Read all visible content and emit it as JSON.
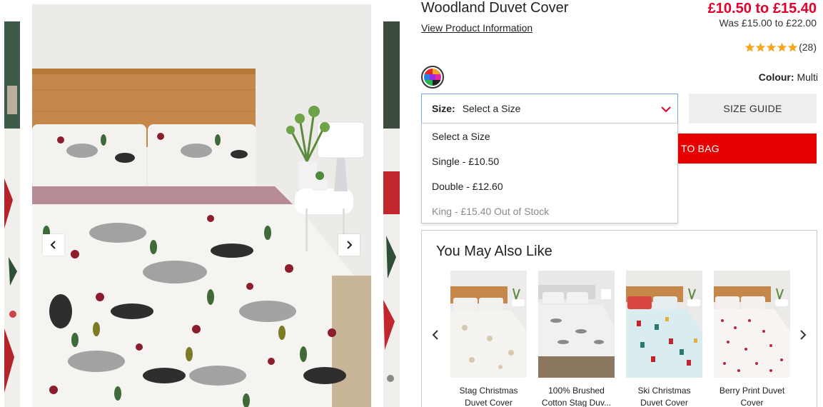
{
  "product": {
    "title": "Woodland Duvet Cover",
    "view_info_link": "View Product Information",
    "price": "£10.50 to £15.40",
    "was_price": "Was £15.00 to £22.00",
    "rating_count": "(28)",
    "rating_stars": 5
  },
  "colour": {
    "label": "Colour:",
    "value": "Multi"
  },
  "size": {
    "label": "Size:",
    "value": "Select a Size",
    "options": [
      {
        "label": "Select a Size",
        "disabled": false
      },
      {
        "label": "Single - £10.50",
        "disabled": false
      },
      {
        "label": "Double - £12.60",
        "disabled": false
      },
      {
        "label": "King - £15.40 Out of Stock",
        "disabled": true
      }
    ]
  },
  "buttons": {
    "size_guide": "SIZE GUIDE",
    "add_to_bag": "TO BAG"
  },
  "recommendations": {
    "title": "You May Also Like",
    "items": [
      {
        "name": "Stag Christmas Duvet Cover"
      },
      {
        "name": "100% Brushed Cotton Stag Duv..."
      },
      {
        "name": "Ski Christmas Duvet Cover"
      },
      {
        "name": "Berry Print Duvet Cover"
      }
    ]
  },
  "colors": {
    "price_red": "#e4002b",
    "button_red": "#e60000",
    "star_orange": "#f5a623",
    "select_border": "#7aa7e8"
  }
}
